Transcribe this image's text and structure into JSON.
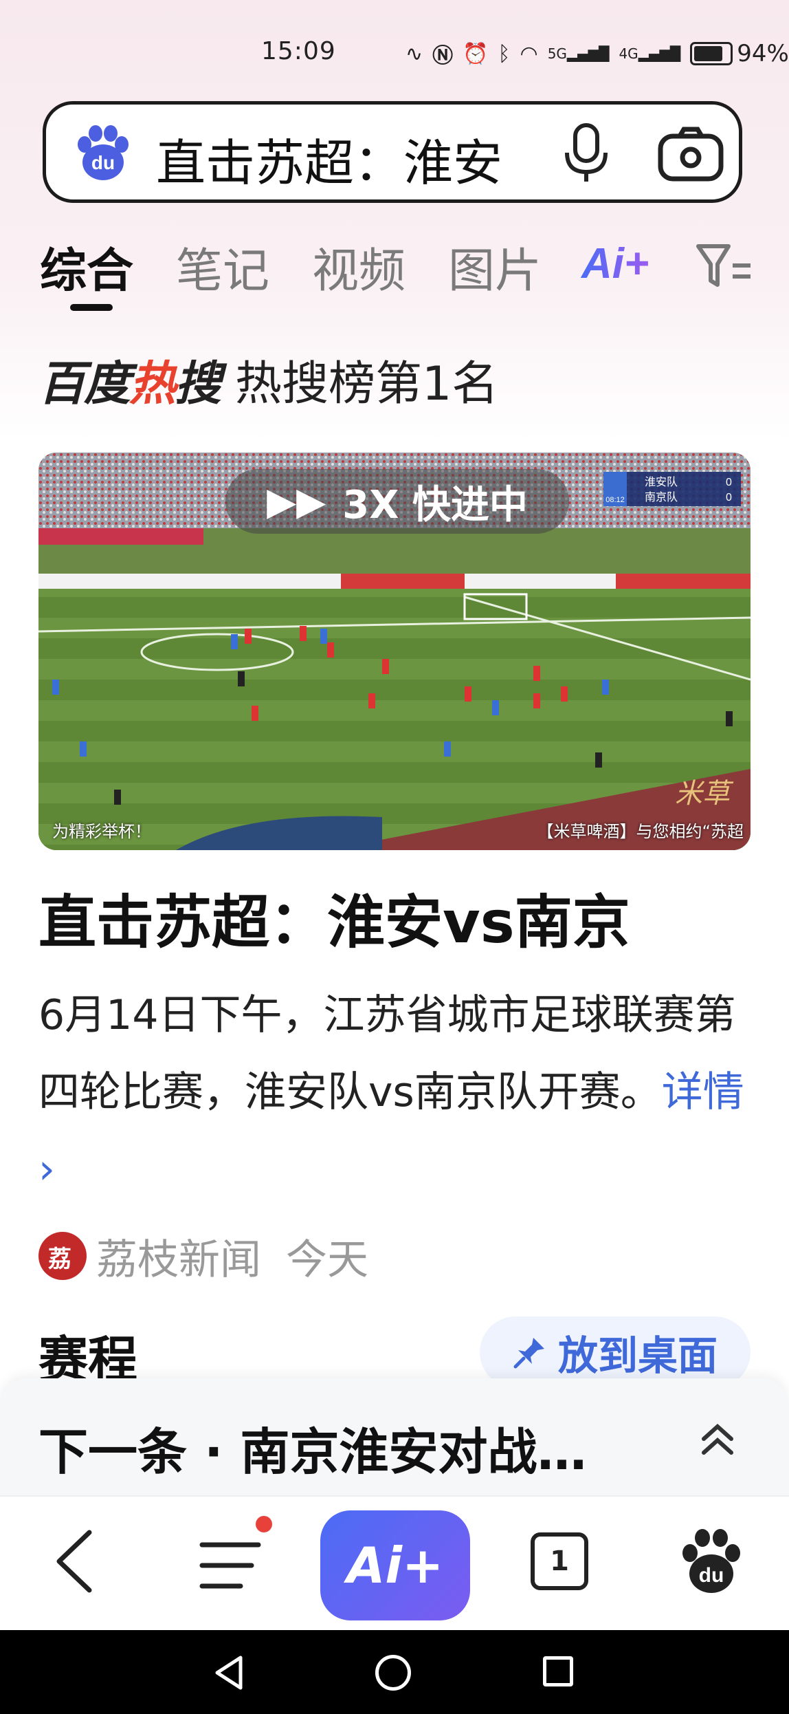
{
  "status_bar": {
    "time": "15:09",
    "network_5g": "5G",
    "network_4g": "4G",
    "battery_percent": "94%",
    "battery_level": 0.94
  },
  "search": {
    "query": "直击苏超：淮安"
  },
  "tabs": [
    {
      "label": "综合",
      "active": true
    },
    {
      "label": "笔记",
      "active": false
    },
    {
      "label": "视频",
      "active": false
    },
    {
      "label": "图片",
      "active": false
    }
  ],
  "ai_tab_label": "Ai+",
  "hot": {
    "brand_black_1": "百度",
    "brand_red": "热",
    "brand_black_2": "搜",
    "rank_text": "热搜榜第1名"
  },
  "video": {
    "fast_forward_label": "3X 快进中",
    "scoreboard": {
      "time": "08:12",
      "team1": "淮安队",
      "score1": "0",
      "team2": "南京队",
      "score2": "0"
    },
    "caption_left": "为精彩举杯！",
    "caption_right": "【米草啤酒】与您相约“苏超",
    "watermark": "米草"
  },
  "article": {
    "headline": "直击苏超：淮安vs南京",
    "summary": "6月14日下午，江苏省城市足球联赛第四轮比赛，淮安队vs南京队开赛。",
    "detail_link": "详情 ›",
    "source_avatar_text": "荔",
    "source_name": "荔枝新闻",
    "time": "今天"
  },
  "schedule_title": "赛程",
  "desktop_button_label": "放到桌面",
  "next_bar_text": "下一条 · 南京淮安对战…",
  "bottom_bar": {
    "ai_label": "Ai+",
    "tab_count": "1"
  },
  "colors": {
    "accent_blue": "#3f68d8",
    "brand_red": "#e8412d",
    "ai_gradient_start": "#4b6cf5",
    "ai_gradient_end": "#7b5cf0"
  }
}
